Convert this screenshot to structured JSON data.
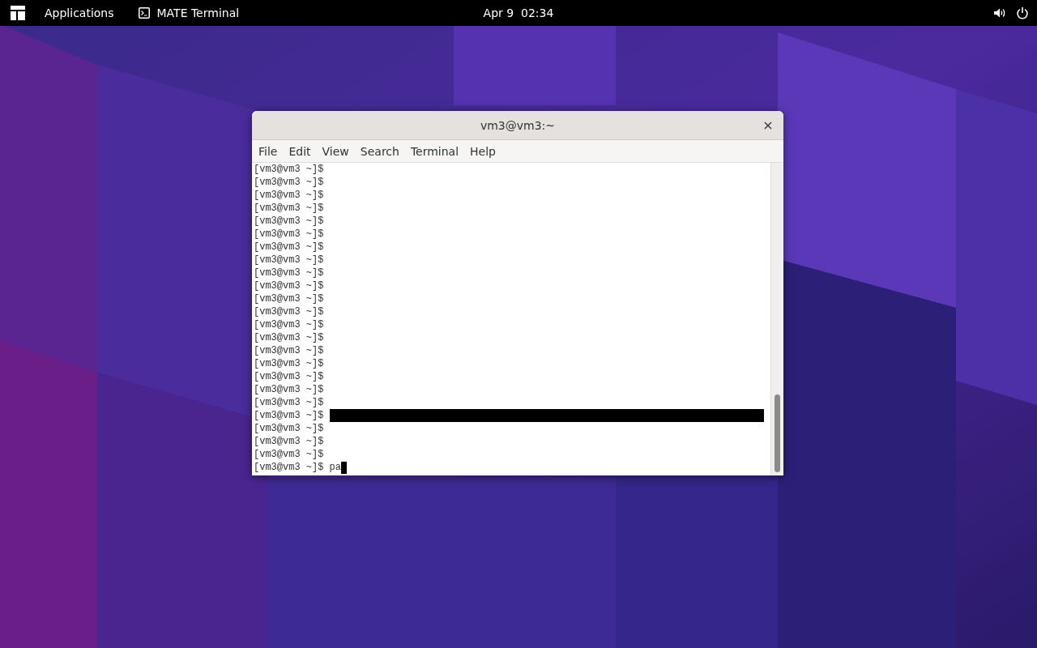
{
  "top_bar": {
    "applications": "Applications",
    "active_app": "MATE Terminal",
    "clock": "Apr 9  02:34"
  },
  "window": {
    "title": "vm3@vm3:~",
    "close": "×"
  },
  "menu": [
    "File",
    "Edit",
    "View",
    "Search",
    "Terminal",
    "Help"
  ],
  "terminal_lines": [
    {
      "text": "[vm3@vm3 ~]$",
      "redacted": false,
      "cursor": false
    },
    {
      "text": "[vm3@vm3 ~]$",
      "redacted": false,
      "cursor": false
    },
    {
      "text": "[vm3@vm3 ~]$",
      "redacted": false,
      "cursor": false
    },
    {
      "text": "[vm3@vm3 ~]$",
      "redacted": false,
      "cursor": false
    },
    {
      "text": "[vm3@vm3 ~]$",
      "redacted": false,
      "cursor": false
    },
    {
      "text": "[vm3@vm3 ~]$",
      "redacted": false,
      "cursor": false
    },
    {
      "text": "[vm3@vm3 ~]$",
      "redacted": false,
      "cursor": false
    },
    {
      "text": "[vm3@vm3 ~]$",
      "redacted": false,
      "cursor": false
    },
    {
      "text": "[vm3@vm3 ~]$",
      "redacted": false,
      "cursor": false
    },
    {
      "text": "[vm3@vm3 ~]$",
      "redacted": false,
      "cursor": false
    },
    {
      "text": "[vm3@vm3 ~]$",
      "redacted": false,
      "cursor": false
    },
    {
      "text": "[vm3@vm3 ~]$",
      "redacted": false,
      "cursor": false
    },
    {
      "text": "[vm3@vm3 ~]$",
      "redacted": false,
      "cursor": false
    },
    {
      "text": "[vm3@vm3 ~]$",
      "redacted": false,
      "cursor": false
    },
    {
      "text": "[vm3@vm3 ~]$",
      "redacted": false,
      "cursor": false
    },
    {
      "text": "[vm3@vm3 ~]$",
      "redacted": false,
      "cursor": false
    },
    {
      "text": "[vm3@vm3 ~]$",
      "redacted": false,
      "cursor": false
    },
    {
      "text": "[vm3@vm3 ~]$",
      "redacted": false,
      "cursor": false
    },
    {
      "text": "[vm3@vm3 ~]$",
      "redacted": false,
      "cursor": false
    },
    {
      "text": "[vm3@vm3 ~]$",
      "redacted": true,
      "cursor": false
    },
    {
      "text": "[vm3@vm3 ~]$",
      "redacted": false,
      "cursor": false
    },
    {
      "text": "[vm3@vm3 ~]$",
      "redacted": false,
      "cursor": false
    },
    {
      "text": "[vm3@vm3 ~]$",
      "redacted": false,
      "cursor": false
    },
    {
      "text": "[vm3@vm3 ~]$ pa",
      "redacted": false,
      "cursor": true
    }
  ]
}
